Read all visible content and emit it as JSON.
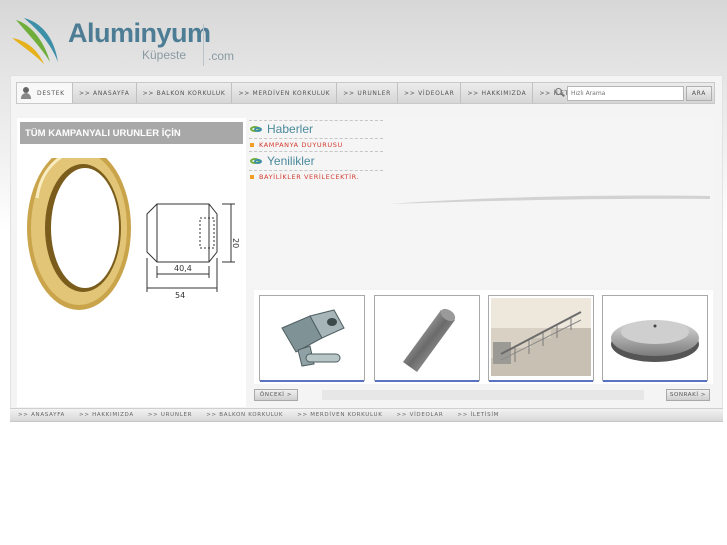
{
  "brand": {
    "title": "Aluminyum",
    "subtitle": "Küpeste",
    "domain": ".com",
    "colors": {
      "primary": "#4d7d95",
      "green": "#6fae3b",
      "yellow": "#e6b21b",
      "teal": "#3e8fa8"
    }
  },
  "nav": {
    "destek": "DESTEK",
    "items": [
      ">> ANASAYFA",
      ">> BALKON KORKULUK",
      ">> MERDİVEN KORKULUK",
      ">> URUNLER",
      ">> VİDEOLAR",
      ">> HAKKIMIZDA",
      ">> İLETİSİM"
    ],
    "search_placeholder": "Hızlı Arama",
    "search_button": "ARA"
  },
  "left": {
    "header": "TÜM KAMPANYALI URUNLER İÇİN",
    "drawing_labels": {
      "height": "20",
      "width_top": "40,4",
      "width_bottom": "54"
    }
  },
  "news": {
    "haberler": "Haberler",
    "haberler_item": "KAMPANYA DUYURUSU",
    "yenilikler": "Yenilikler",
    "yenilikler_item": "BAYİLİKLER VERİLECEKTİR."
  },
  "pager": {
    "prev": "ÖNCEKİ >",
    "next": "SONRAKİ >"
  },
  "footer": {
    "items": [
      ">> ANASAYFA",
      ">> HAKKIMIZDA",
      ">> URUNLER",
      ">> BALKON KORKULUK",
      ">> MERDİVEN KORKULUK",
      ">> VİDEOLAR",
      ">> İLETİSİM"
    ]
  },
  "icons": [
    "brand-leaf-icon",
    "user-icon",
    "search-icon",
    "haberler-logo-icon",
    "yenilikler-logo-icon"
  ]
}
